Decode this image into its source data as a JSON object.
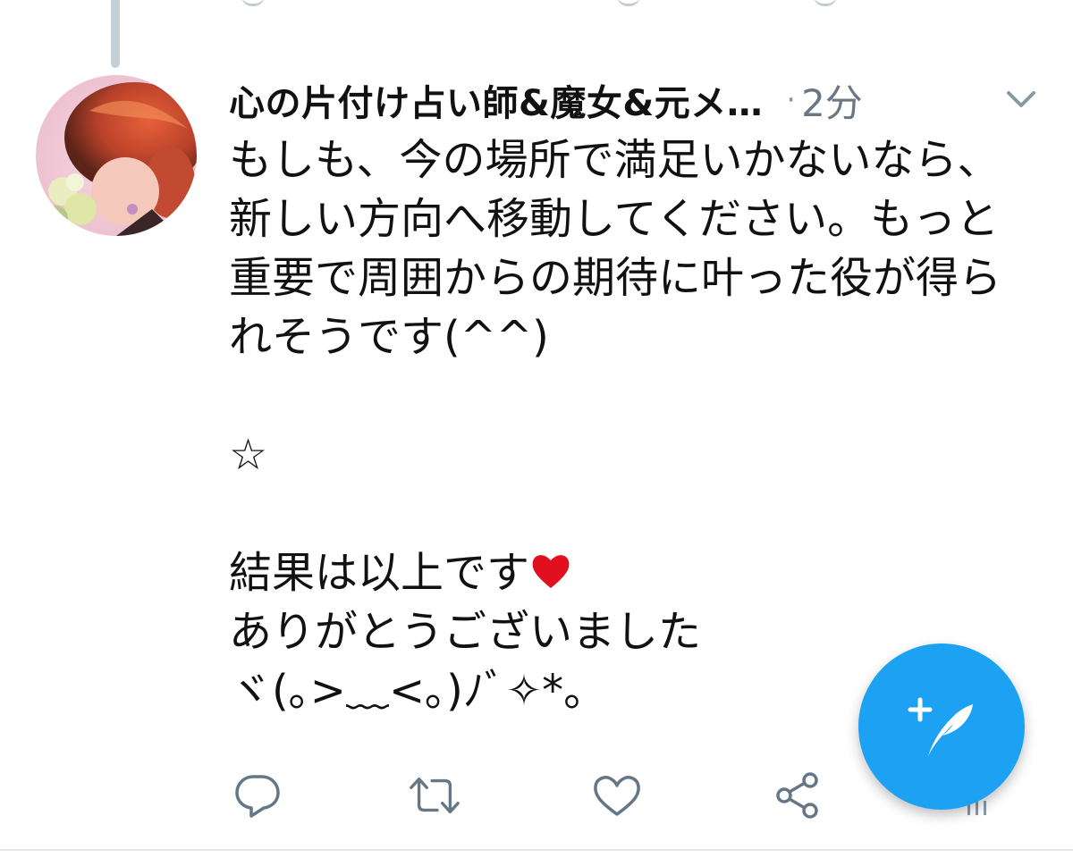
{
  "tweet": {
    "display_name": "心の片付け占い師&魔女&元メ…",
    "separator": "·",
    "timestamp": "2分",
    "body_lines": [
      "もしも、今の場所で満足いかないなら、",
      "新しい方向へ移動してください。もっと",
      "重要で周囲からの期待に叶った役が得ら",
      "れそうです(^^)",
      "",
      "☆",
      "",
      "結果は以上です",
      "ありがとうございました",
      "ヾ(｡>﹏<｡)ﾉﾞ✧*。"
    ]
  },
  "icons": {
    "avatar": "profile-photo",
    "menu": "chevron-down-icon",
    "reply": "reply-icon",
    "retweet": "retweet-icon",
    "like": "heart-icon",
    "share": "share-icon",
    "compose": "compose-tweet-icon",
    "emoji": "red-heart-emoji"
  },
  "colors": {
    "accent": "#1da1f2",
    "text": "#111111",
    "secondary_text": "#697884",
    "icon_gray": "#657786",
    "heart_emoji": "#e0101e",
    "thread_line": "#c4cfd6"
  }
}
